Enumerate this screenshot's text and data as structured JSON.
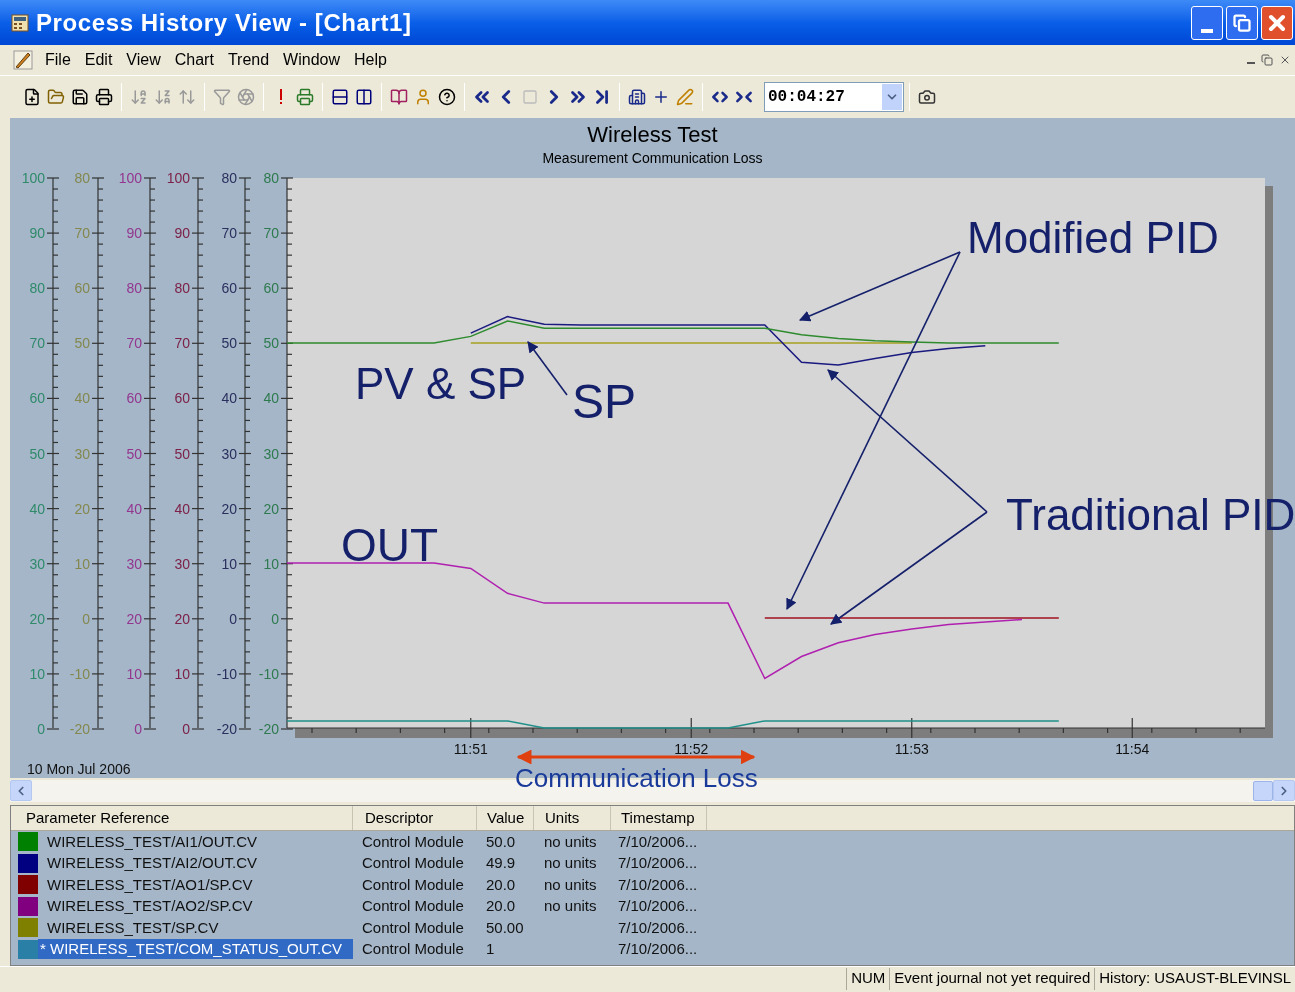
{
  "window": {
    "title": "Process History View - [Chart1]"
  },
  "menu": [
    "File",
    "Edit",
    "View",
    "Chart",
    "Trend",
    "Window",
    "Help"
  ],
  "toolbar": {
    "time_value": "00:04:27"
  },
  "chart": {
    "subtitle": "Measurement Communication Loss",
    "date": "10 Mon Jul 2006",
    "left_axes": [
      {
        "color": "#2f8a6a",
        "labels": [
          "100",
          "90",
          "80",
          "70",
          "60",
          "50",
          "40",
          "30",
          "20",
          "10",
          "0"
        ]
      },
      {
        "color": "#84884e",
        "labels": [
          "80",
          "70",
          "60",
          "50",
          "40",
          "30",
          "20",
          "10",
          "0",
          "-10",
          "-20"
        ]
      },
      {
        "color": "#93368f",
        "labels": [
          "100",
          "90",
          "80",
          "70",
          "60",
          "50",
          "40",
          "30",
          "20",
          "10",
          "0"
        ]
      },
      {
        "color": "#7e2148",
        "labels": [
          "100",
          "90",
          "80",
          "70",
          "60",
          "50",
          "40",
          "30",
          "20",
          "10",
          "0"
        ]
      },
      {
        "color": "#2b2f5e",
        "labels": [
          "80",
          "70",
          "60",
          "50",
          "40",
          "30",
          "20",
          "10",
          "0",
          "-10",
          "-20"
        ]
      }
    ],
    "chart_data": {
      "type": "line",
      "title": "Wireless Test",
      "categories": [
        null,
        null,
        null,
        null,
        null,
        "11:51",
        null,
        null,
        null,
        null,
        null,
        "11:52",
        null,
        null,
        null,
        null,
        null,
        "11:53",
        null,
        null,
        null,
        null,
        null,
        "11:54",
        null,
        null,
        null
      ],
      "series": [
        {
          "color": "#a6a020",
          "values": [
            null,
            null,
            null,
            null,
            null,
            50,
            50,
            50,
            50,
            50,
            50,
            50,
            50,
            50,
            50,
            50,
            50,
            50,
            null,
            null,
            null,
            null,
            null,
            null,
            null,
            null,
            null
          ]
        },
        {
          "color": "#1a1a80",
          "values": [
            null,
            null,
            null,
            null,
            null,
            51.8,
            54.8,
            53.4,
            53.3,
            53.3,
            53.3,
            53.3,
            53.3,
            53.3,
            46.5,
            46,
            47.2,
            48.3,
            49,
            49.5,
            null,
            null,
            null,
            null,
            null,
            null,
            null
          ]
        },
        {
          "color": "#2e8b2e",
          "values": [
            50,
            50,
            50,
            50,
            50,
            51.2,
            54,
            52.7,
            52.7,
            52.7,
            52.7,
            52.7,
            52.7,
            52.7,
            51.5,
            50.8,
            50.4,
            50.2,
            50,
            50,
            50,
            50,
            null,
            null,
            null,
            null,
            null
          ]
        },
        {
          "color": "#a01020",
          "values": [
            null,
            null,
            null,
            null,
            null,
            null,
            null,
            null,
            null,
            null,
            null,
            null,
            null,
            0,
            0,
            0,
            0,
            0,
            0,
            0,
            0,
            0,
            null,
            null,
            null,
            null,
            null
          ]
        },
        {
          "color": "#b020b0",
          "values": [
            10,
            10,
            10,
            10,
            10,
            9,
            4.5,
            2.7,
            2.7,
            2.7,
            2.7,
            2.7,
            2.7,
            -11,
            -7,
            -4.5,
            -3,
            -2,
            -1.2,
            -0.7,
            -0.3,
            null,
            null,
            null,
            null,
            null,
            null
          ]
        },
        {
          "color": "#20908a",
          "values": [
            -18.7,
            -18.7,
            -18.7,
            -18.7,
            -18.7,
            -18.7,
            -18.7,
            -20,
            -20,
            -20,
            -20,
            -20,
            -20,
            -18.7,
            -18.7,
            -18.7,
            -18.7,
            -18.7,
            -18.7,
            -18.7,
            -18.7,
            -18.7,
            null,
            null,
            null,
            null,
            null
          ]
        }
      ],
      "ylim": [
        -20,
        80
      ],
      "yticks": [
        80,
        70,
        60,
        50,
        40,
        30,
        20,
        10,
        0,
        -10,
        -20
      ]
    },
    "annotations": [
      {
        "kind": "callout",
        "text": "Modified PID"
      },
      {
        "kind": "callout",
        "text": "PV & SP"
      },
      {
        "kind": "callout",
        "text": "SP"
      },
      {
        "kind": "callout",
        "text": "OUT"
      },
      {
        "kind": "callout",
        "text": "Traditional PID"
      },
      {
        "kind": "span",
        "text": "Communication Loss"
      }
    ]
  },
  "table": {
    "columns": [
      "Parameter Reference",
      "Descriptor",
      "Value",
      "Units",
      "Timestamp"
    ],
    "rows": [
      {
        "color": "#008000",
        "name": "WIRELESS_TEST/AI1/OUT.CV",
        "descriptor": "Control Module",
        "value": "50.0",
        "units": "no units",
        "timestamp": "7/10/2006...",
        "selected": false
      },
      {
        "color": "#000080",
        "name": "WIRELESS_TEST/AI2/OUT.CV",
        "descriptor": "Control Module",
        "value": "49.9",
        "units": "no units",
        "timestamp": "7/10/2006...",
        "selected": false
      },
      {
        "color": "#800000",
        "name": "WIRELESS_TEST/AO1/SP.CV",
        "descriptor": "Control Module",
        "value": "20.0",
        "units": "no units",
        "timestamp": "7/10/2006...",
        "selected": false
      },
      {
        "color": "#800080",
        "name": "WIRELESS_TEST/AO2/SP.CV",
        "descriptor": "Control Module",
        "value": "20.0",
        "units": "no units",
        "timestamp": "7/10/2006...",
        "selected": false
      },
      {
        "color": "#808000",
        "name": "WIRELESS_TEST/SP.CV",
        "descriptor": "Control Module",
        "value": "50.00",
        "timestamp": "7/10/2006...",
        "selected": false
      },
      {
        "color": "#2a7fa6",
        "name": "* WIRELESS_TEST/COM_STATUS_OUT.CV",
        "descriptor": "Control Module",
        "value": "1",
        "timestamp": "7/10/2006...",
        "selected": true
      }
    ]
  },
  "status_bar": [
    "NUM",
    "Event journal not yet required",
    "History: USAUST-BLEVINSL"
  ]
}
